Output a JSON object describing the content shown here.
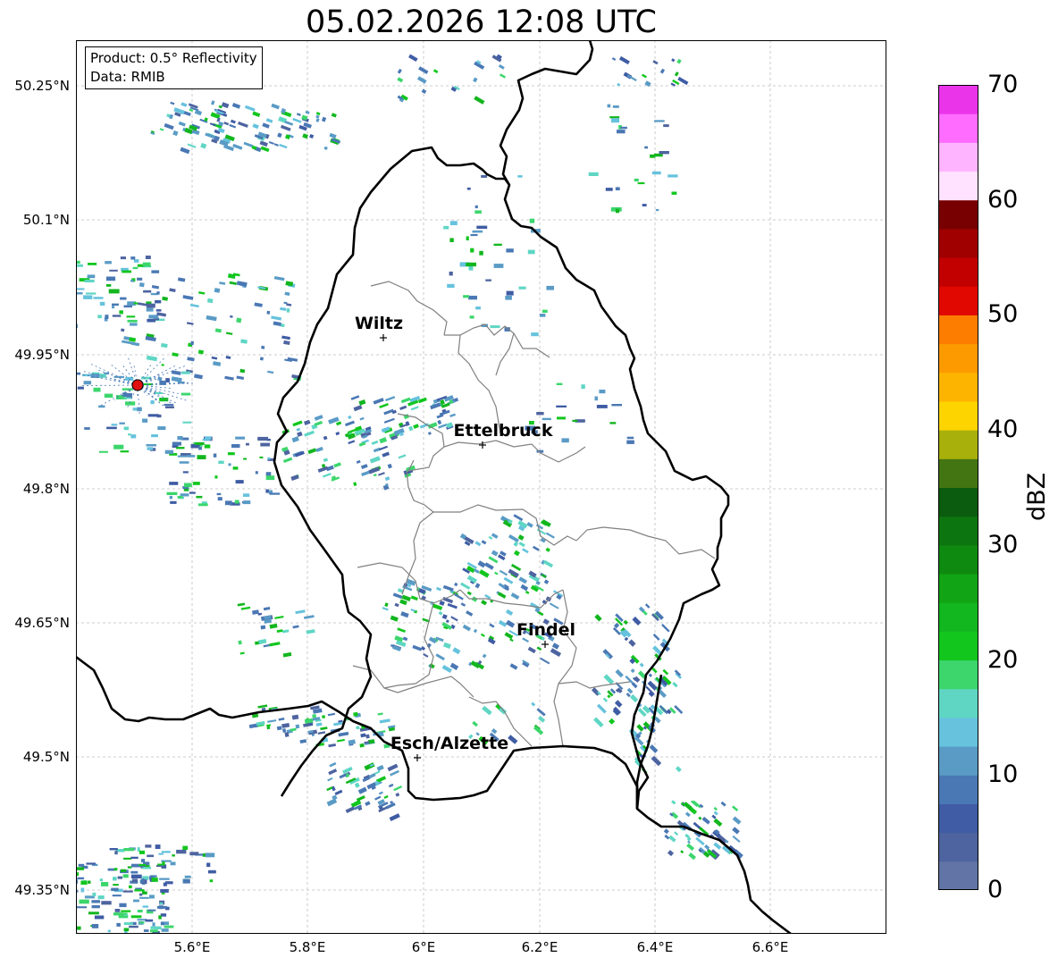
{
  "title": "05.02.2026 12:08 UTC",
  "info": {
    "product": "Product: 0.5° Reflectivity",
    "data": "Data: RMIB"
  },
  "latitude_ticks": [
    "50.25°N",
    "50.1°N",
    "49.95°N",
    "49.8°N",
    "49.65°N",
    "49.5°N",
    "49.35°N"
  ],
  "longitude_ticks": [
    "5.6°E",
    "5.8°E",
    "6°E",
    "6.2°E",
    "6.4°E",
    "6.6°E"
  ],
  "cities": [
    {
      "name": "Wiltz"
    },
    {
      "name": "Ettelbruck"
    },
    {
      "name": "Findel"
    },
    {
      "name": "Esch/Alzette"
    }
  ],
  "colorbar": {
    "unit": "dBZ",
    "ticks": [
      "0",
      "10",
      "20",
      "30",
      "40",
      "50",
      "60",
      "70"
    ],
    "colors": [
      "#6274a5",
      "#4e64a0",
      "#3f5ca4",
      "#4a78b4",
      "#5a9bc6",
      "#66c2dd",
      "#5fd6c4",
      "#3cd66c",
      "#12c61e",
      "#12b61e",
      "#11a414",
      "#0f8a10",
      "#0d7510",
      "#0b5c0e",
      "#437612",
      "#a8b00b",
      "#fdd400",
      "#fdb400",
      "#fd9a00",
      "#fc7d00",
      "#e00800",
      "#c20000",
      "#a00000",
      "#780000",
      "#ffe2ff",
      "#ffb4ff",
      "#ff6cff",
      "#ea34ea"
    ]
  },
  "radar_site": {
    "color": "#e01010"
  }
}
